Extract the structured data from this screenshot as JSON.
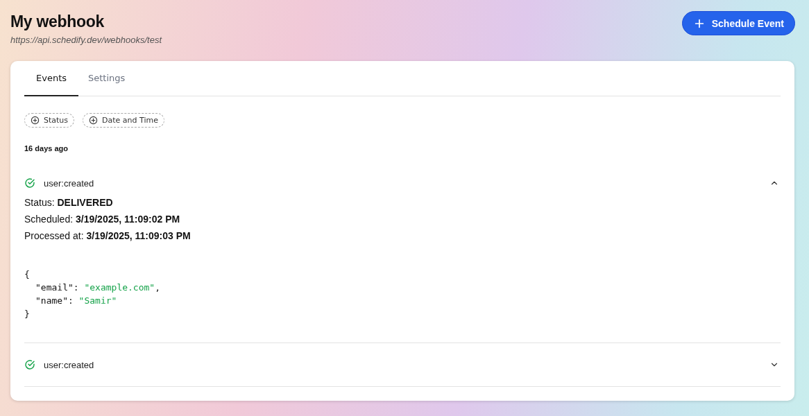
{
  "header": {
    "title": "My webhook",
    "url": "https://api.schedify.dev/webhooks/test",
    "action_button": "Schedule Event"
  },
  "tabs": [
    {
      "label": "Events",
      "selected": true
    },
    {
      "label": "Settings",
      "selected": false
    }
  ],
  "filters": [
    "Status",
    "Date and Time"
  ],
  "group_label": "16 days ago",
  "events": [
    {
      "name": "user:created",
      "kind": "success",
      "expanded": true,
      "details": [
        "Status: **DELIVERED**",
        "Scheduled: **3/19/2025, 11:09:02 PM**",
        "Processed at: **3/19/2025, 11:09:03 PM**"
      ],
      "payload": [
        {
          "kind": "brace",
          "text": "{"
        },
        {
          "kind": "pair",
          "key": "\"email\":",
          "value": "\"example.com\"",
          "trail": ","
        },
        {
          "kind": "pair",
          "key": "\"name\":",
          "value": "\"Samir\""
        },
        {
          "kind": "brace",
          "text": "}"
        }
      ]
    },
    {
      "name": "user:created",
      "kind": "success",
      "expanded": false
    }
  ]
}
